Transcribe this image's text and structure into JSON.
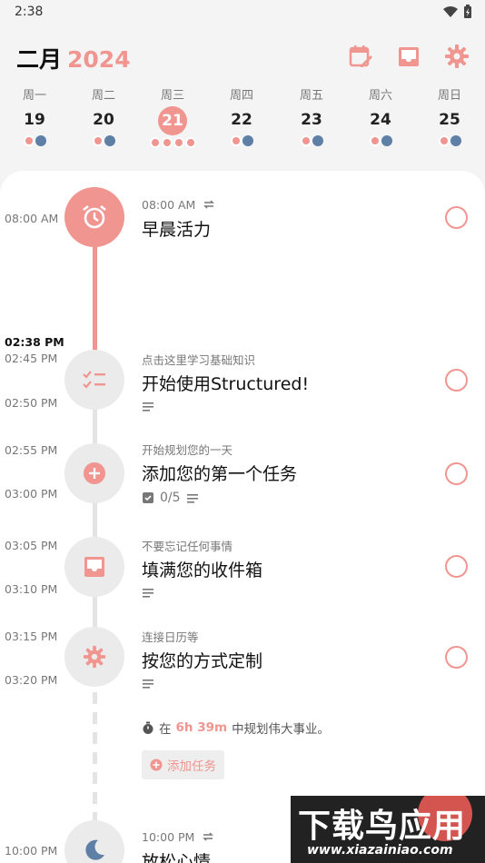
{
  "status_bar": {
    "time": "2:38"
  },
  "header": {
    "month": "二月",
    "year": "2024"
  },
  "week": [
    {
      "name": "周一",
      "num": "19",
      "active": false,
      "dots": [
        "pink",
        "blue"
      ]
    },
    {
      "name": "周二",
      "num": "20",
      "active": false,
      "dots": [
        "pink",
        "blue"
      ]
    },
    {
      "name": "周三",
      "num": "21",
      "active": true,
      "dots": [
        "pink",
        "pink",
        "pink",
        "pink"
      ]
    },
    {
      "name": "周四",
      "num": "22",
      "active": false,
      "dots": [
        "pink",
        "blue"
      ]
    },
    {
      "name": "周五",
      "num": "23",
      "active": false,
      "dots": [
        "pink",
        "blue"
      ]
    },
    {
      "name": "周六",
      "num": "24",
      "active": false,
      "dots": [
        "pink",
        "blue"
      ]
    },
    {
      "name": "周日",
      "num": "25",
      "active": false,
      "dots": [
        "pink",
        "blue"
      ]
    }
  ],
  "time_labels": {
    "t0800": "08:00 AM",
    "now": "02:38 PM",
    "t0245": "02:45 PM",
    "t0250": "02:50 PM",
    "t0255": "02:55 PM",
    "t0300": "03:00 PM",
    "t0305": "03:05 PM",
    "t0310": "03:10 PM",
    "t0315": "03:15 PM",
    "t0320": "03:20 PM",
    "t1000": "10:00 PM"
  },
  "tasks": {
    "wake": {
      "time": "08:00 AM",
      "title": "早晨活力"
    },
    "learn": {
      "subtitle": "点击这里学习基础知识",
      "title": "开始使用Structured!"
    },
    "add_first": {
      "subtitle": "开始规划您的一天",
      "title": "添加您的第一个任务",
      "subtasks": "0/5"
    },
    "inbox": {
      "subtitle": "不要忘记任何事情",
      "title": "填满您的收件箱"
    },
    "customize": {
      "subtitle": "连接日历等",
      "title": "按您的方式定制"
    },
    "relax": {
      "time": "10:00 PM",
      "title": "放松心情"
    }
  },
  "free_time": {
    "prefix": "在",
    "duration": "6h 39m",
    "suffix": "中规划伟大事业。"
  },
  "add_task_label": "添加任务",
  "watermark": {
    "main": "下载鸟应用",
    "sub": "www.xiazainiao.com"
  },
  "colors": {
    "accent": "#f0958f",
    "moon_blue": "#5e7fa6",
    "node_grey": "#ebebeb"
  }
}
